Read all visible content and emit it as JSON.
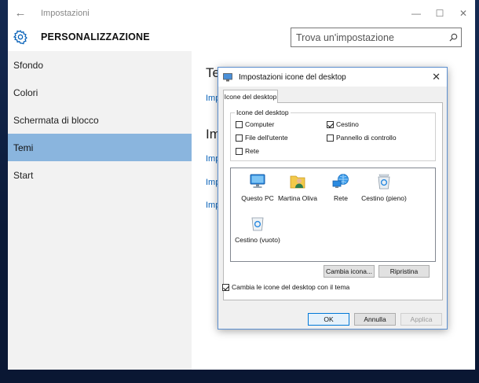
{
  "window": {
    "app_title": "Impostazioni",
    "back_glyph": "←",
    "minimize_glyph": "—",
    "maximize_glyph": "☐",
    "close_glyph": "✕"
  },
  "header": {
    "section_title": "PERSONALIZZAZIONE",
    "search_placeholder": "Trova un'impostazione"
  },
  "sidebar": {
    "items": [
      {
        "label": "Sfondo"
      },
      {
        "label": "Colori"
      },
      {
        "label": "Schermata di blocco"
      },
      {
        "label": "Temi"
      },
      {
        "label": "Start"
      }
    ],
    "active_index": 3
  },
  "content": {
    "heading_1": "Te",
    "link_1": "Imp",
    "heading_2": "Im",
    "link_2": "Imp",
    "link_3": "Imp",
    "link_4": "Imp"
  },
  "dialog": {
    "title": "Impostazioni icone del desktop",
    "close_glyph": "✕",
    "tab_label": "Icone del desktop",
    "group_label": "Icone del desktop",
    "checkboxes": {
      "computer": {
        "label": "Computer",
        "checked": false
      },
      "user_files": {
        "label": "File dell'utente",
        "checked": false
      },
      "network": {
        "label": "Rete",
        "checked": false
      },
      "recycle_bin": {
        "label": "Cestino",
        "checked": true
      },
      "control_panel": {
        "label": "Pannello di controllo",
        "checked": false
      }
    },
    "icons": [
      {
        "label": "Questo PC",
        "icon": "computer-icon"
      },
      {
        "label": "Martina Oliva",
        "icon": "user-folder-icon"
      },
      {
        "label": "Rete",
        "icon": "network-icon"
      },
      {
        "label": "Cestino (pieno)",
        "icon": "recycle-bin-full-icon"
      },
      {
        "label": "Cestino (vuoto)",
        "icon": "recycle-bin-empty-icon"
      }
    ],
    "change_icon_label": "Cambia icona...",
    "restore_label": "Ripristina",
    "theme_checkbox": {
      "label": "Cambia le icone del desktop con il tema",
      "checked": true
    },
    "ok_label": "OK",
    "cancel_label": "Annulla",
    "apply_label": "Applica"
  },
  "colors": {
    "accent": "#0078d7",
    "nav_active": "#8ab5de",
    "link": "#0a63b9"
  }
}
